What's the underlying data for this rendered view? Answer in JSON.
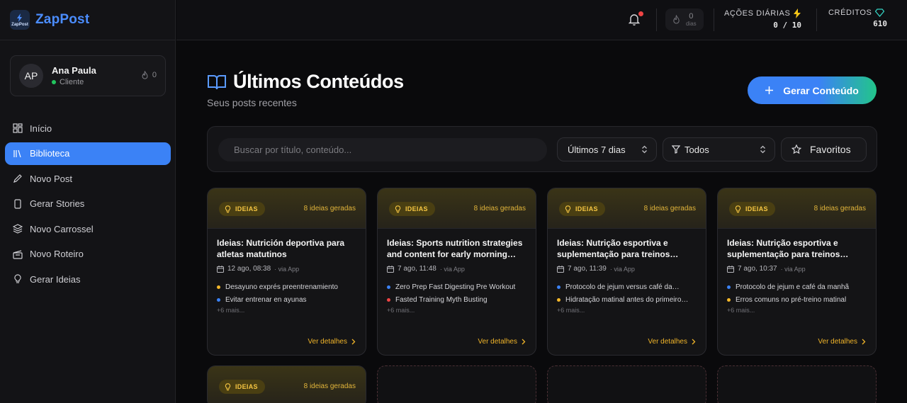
{
  "brand": {
    "name": "ZapPost",
    "logo_text": "ZapPost"
  },
  "user": {
    "initials": "AP",
    "name": "Ana Paula",
    "role": "Cliente",
    "streak": "0"
  },
  "nav": [
    {
      "label": "Início",
      "icon": "grid-icon",
      "active": false
    },
    {
      "label": "Biblioteca",
      "icon": "library-icon",
      "active": true
    },
    {
      "label": "Novo Post",
      "icon": "pencil-icon",
      "active": false
    },
    {
      "label": "Gerar Stories",
      "icon": "phone-icon",
      "active": false
    },
    {
      "label": "Novo Carrossel",
      "icon": "layers-icon",
      "active": false
    },
    {
      "label": "Novo Roteiro",
      "icon": "clapper-icon",
      "active": false
    },
    {
      "label": "Gerar Ideias",
      "icon": "lightbulb-icon",
      "active": false
    }
  ],
  "topbar": {
    "streak_value": "0",
    "streak_label": "dias",
    "daily_label": "AÇÕES DIÁRIAS",
    "daily_value": "0 / 10",
    "credits_label": "CRÉDITOS",
    "credits_value": "610"
  },
  "page": {
    "title": "Últimos Conteúdos",
    "subtitle": "Seus posts recentes",
    "generate_label": "Gerar Conteúdo"
  },
  "filters": {
    "search_placeholder": "Buscar por título, conteúdo...",
    "period": "Últimos 7 dias",
    "type": "Todos",
    "favorites": "Favoritos"
  },
  "cards": [
    {
      "badge": "IDEIAS",
      "count": "8 ideias geradas",
      "title": "Ideias: Nutrición deportiva para atletas matutinos",
      "date": "12 ago, 08:38",
      "via": "· via App",
      "bullets": [
        {
          "text": "Desayuno exprés preentrenamiento",
          "color": "#f5b82a"
        },
        {
          "text": "Evitar entrenar en ayunas",
          "color": "#3b82f6"
        }
      ],
      "more": "+6 mais...",
      "details": "Ver detalhes"
    },
    {
      "badge": "IDEIAS",
      "count": "8 ideias geradas",
      "title": "Ideias: Sports nutrition strategies and content for early morning…",
      "date": "7 ago, 11:48",
      "via": "· via App",
      "bullets": [
        {
          "text": "Zero Prep Fast Digesting Pre Workout",
          "color": "#3b82f6"
        },
        {
          "text": "Fasted Training Myth Busting",
          "color": "#ef4444"
        }
      ],
      "more": "+6 mais...",
      "details": "Ver detalhes"
    },
    {
      "badge": "IDEIAS",
      "count": "8 ideias geradas",
      "title": "Ideias: Nutrição esportiva e suplementação para treinos…",
      "date": "7 ago, 11:39",
      "via": "· via App",
      "bullets": [
        {
          "text": "Protocolo de jejum versus café da…",
          "color": "#3b82f6"
        },
        {
          "text": "Hidratação matinal antes do primeiro…",
          "color": "#f5b82a"
        }
      ],
      "more": "+6 mais...",
      "details": "Ver detalhes"
    },
    {
      "badge": "IDEIAS",
      "count": "8 ideias geradas",
      "title": "Ideias: Nutrição esportiva e suplementação para treinos…",
      "date": "7 ago, 10:37",
      "via": "· via App",
      "bullets": [
        {
          "text": "Protocolo de jejum e café da manhã",
          "color": "#3b82f6"
        },
        {
          "text": "Erros comuns no pré-treino matinal",
          "color": "#f5b82a"
        }
      ],
      "more": "+6 mais...",
      "details": "Ver detalhes"
    }
  ],
  "partial_card": {
    "badge": "IDEIAS",
    "count": "8 ideias geradas"
  }
}
